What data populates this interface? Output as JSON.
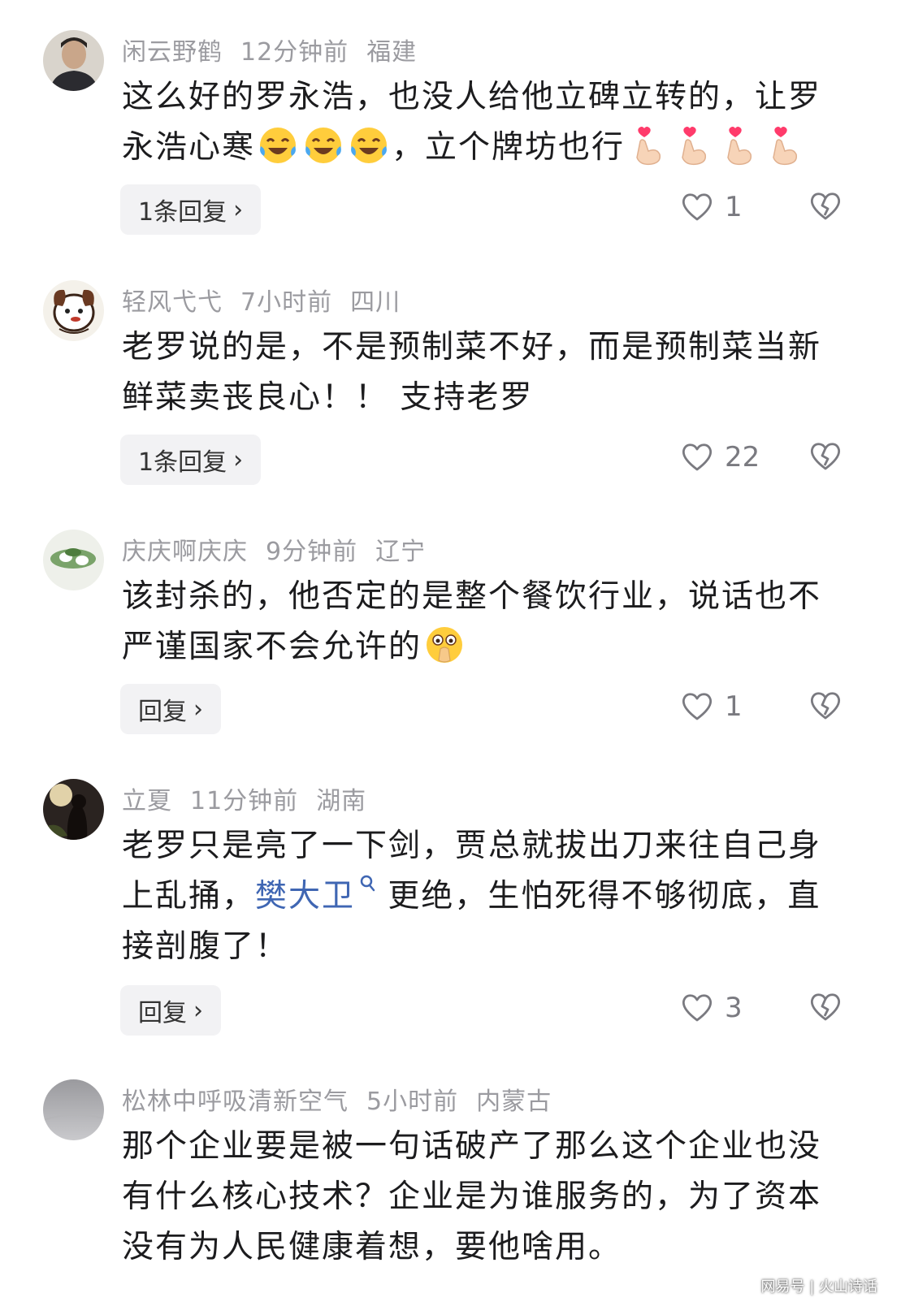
{
  "comments": [
    {
      "username": "闲云野鹤",
      "time": "12分钟前",
      "location": "福建",
      "text_parts": [
        "这么好的罗永浩，也没人给他立碑立转的，让罗永浩心寒",
        "，立个牌坊也行"
      ],
      "emojis_a": [
        "laughing-crying-emoji",
        "laughing-crying-emoji",
        "laughing-crying-emoji"
      ],
      "emojis_b": [
        "finger-heart-emoji",
        "finger-heart-emoji",
        "finger-heart-emoji",
        "finger-heart-emoji"
      ],
      "reply_label": "1条回复",
      "likes": "1"
    },
    {
      "username": "轻风弋弋",
      "time": "7小时前",
      "location": "四川",
      "text": "老罗说的是，不是预制菜不好，而是预制菜当新鲜菜卖丧良心！！ 支持老罗",
      "reply_label": "1条回复",
      "likes": "22"
    },
    {
      "username": "庆庆啊庆庆",
      "time": "9分钟前",
      "location": "辽宁",
      "text": "该封杀的，他否定的是整个餐饮行业，说话也不严谨国家不会允许的",
      "emoji": "shushing-face-emoji",
      "reply_label": "回复",
      "likes": "1"
    },
    {
      "username": "立夏",
      "time": "11分钟前",
      "location": "湖南",
      "text_a": "老罗只是亮了一下剑，贾总就拔出刀来往自己身上乱捅，",
      "mention": "樊大卫",
      "text_b": " 更绝，生怕死得不够彻底，直接剖腹了！",
      "reply_label": "回复",
      "likes": "3"
    },
    {
      "username": "松林中呼吸清新空气",
      "time": "5小时前",
      "location": "内蒙古",
      "text": "那个企业要是被一句话破产了那么这个企业也没有什么核心技术？企业是为谁服务的，为了资本没有为人民健康着想，要他啥用。"
    }
  ],
  "chevron": "›",
  "watermark": "网易号 | 火山诗话",
  "colors": {
    "meta": "#9b9ba0",
    "mention": "#3f66b3",
    "reply_bg": "#f2f2f4"
  }
}
